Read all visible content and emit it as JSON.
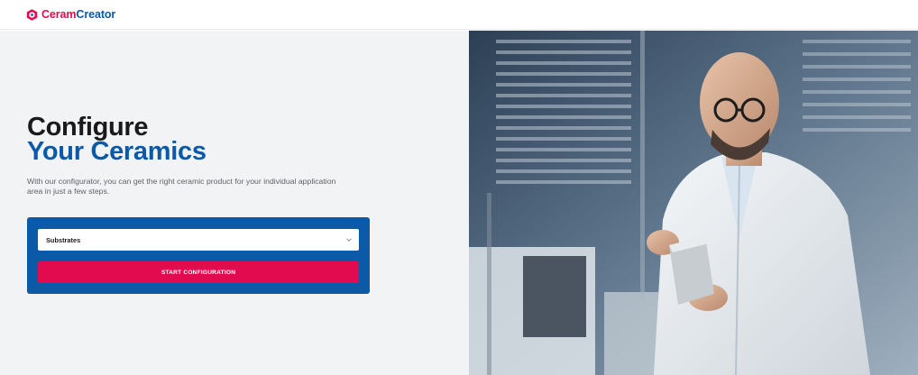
{
  "brand": {
    "name_part1": "Ceram",
    "name_part2": "Creator",
    "accent_color": "#e30b4f",
    "primary_color": "#0a5aa8"
  },
  "hero": {
    "headline_line1": "Configure",
    "headline_line2": "Your Ceramics",
    "intro": "With our configurator, you can get the right ceramic product for your individual application area in just a few steps."
  },
  "configurator": {
    "select_value": "Substrates",
    "start_button": "START CONFIGURATION",
    "chevron_icon": "chevron-down-icon"
  },
  "photo": {
    "icon": "scientist-photo"
  }
}
